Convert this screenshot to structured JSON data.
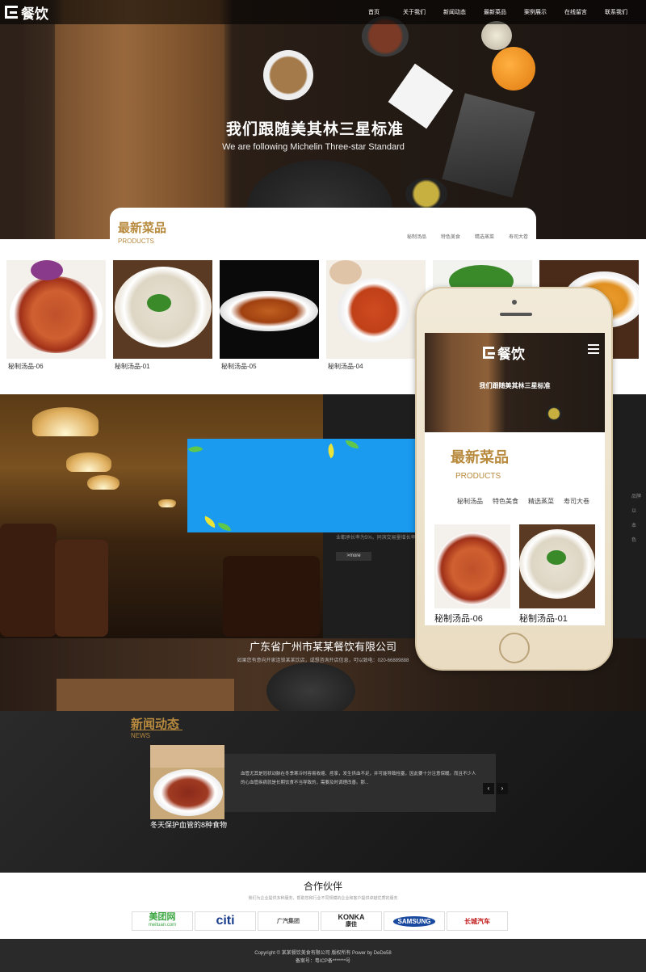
{
  "nav": {
    "logo": "餐饮",
    "items": [
      "首页",
      "关于我们",
      "新闻动态",
      "最新菜品",
      "案例展示",
      "在线留言",
      "联系我们"
    ]
  },
  "hero": {
    "title": "我们跟随美其林三星标准",
    "subtitle": "We are following Michelin Three-star Standard"
  },
  "products": {
    "title": "最新菜品",
    "subtitle": "PRODUCTS",
    "categories": [
      "秘制汤品",
      "特色美食",
      "精选蒸菜",
      "寿司大卷"
    ],
    "items": [
      {
        "name": "秘制汤品-06"
      },
      {
        "name": "秘制汤品-01"
      },
      {
        "name": "秘制汤品-05"
      },
      {
        "name": "秘制汤品-04"
      },
      {
        "name": ""
      },
      {
        "name": ""
      }
    ]
  },
  "about": {
    "text": "业都承长率为5%，同滨交易量增长率",
    "more": ">more",
    "edge": [
      "品牌",
      "以",
      "本",
      "色"
    ]
  },
  "company": {
    "name": "广东省广州市某某餐饮有限公司",
    "desc": "如果您有意向开家连锁某某饮店，或想咨询开店信息，可以致电：020-66889888"
  },
  "news": {
    "title": "新闻动态",
    "subtitle": "NEWS",
    "caption": "冬天保护血管的8种食物",
    "body": "血管尤其是冠状动脉在冬季寒冷时容易收缩、痉挛，发生供血不足，并可能导致栓塞，因此要十分注意保暖。而且不少人的心血管疾病就是长期饮食不当导致的，需要及时调理改善。那...",
    "prev": "‹",
    "next": "›"
  },
  "partners": {
    "title": "合作伙伴",
    "desc": "我们为企业提供多种服务，帮助您和行业不同规模的企业和客户提供卓越优质的服务",
    "logos": [
      {
        "name": "美团网",
        "sub": "meituan.com",
        "color": "#3aa640"
      },
      {
        "name": "citi",
        "sub": "",
        "color": "#1a3c8c"
      },
      {
        "name": "广汽集团",
        "sub": "",
        "color": "#555555"
      },
      {
        "name": "KONKA",
        "sub": "康佳",
        "color": "#222222"
      },
      {
        "name": "SAMSUNG",
        "sub": "",
        "color": "#1a4aa0"
      },
      {
        "name": "长城汽车",
        "sub": "",
        "color": "#c01a1a"
      }
    ]
  },
  "footer": {
    "line1": "Copyright © 某某餐饮美食有限公司 版权所有 Power by DeDe58",
    "line2": "备案号：粤ICP备*******号"
  },
  "phone": {
    "logo": "餐饮",
    "hero_title": "我们跟随美其林三星标准",
    "title": "最新菜品",
    "subtitle": "PRODUCTS",
    "categories": [
      "秘制汤品",
      "特色美食",
      "精选蒸菜",
      "寿司大卷"
    ],
    "items": [
      {
        "name": "秘制汤品-06"
      },
      {
        "name": "秘制汤品-01"
      }
    ]
  },
  "colors": {
    "accent": "#b88a3e",
    "blue_box": "#1a9bf0"
  }
}
